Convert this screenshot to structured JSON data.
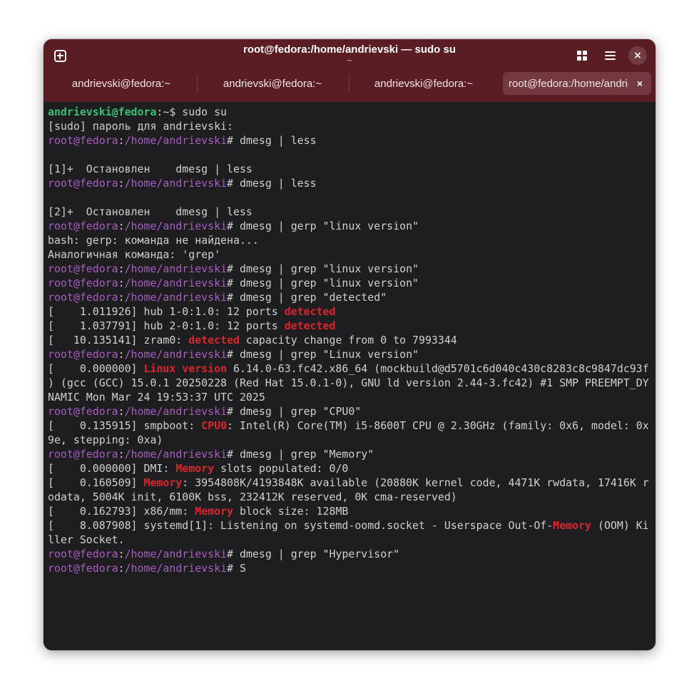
{
  "window": {
    "title": "root@fedora:/home/andrievski — sudo su",
    "subtitle": "~"
  },
  "tabs": [
    {
      "label": "andrievski@fedora:~"
    },
    {
      "label": "andrievski@fedora:~"
    },
    {
      "label": "andrievski@fedora:~"
    },
    {
      "label": "root@fedora:/home/andrievski — sudo su",
      "close": "×"
    }
  ],
  "header_icons": {
    "new_tab": "new-tab-icon",
    "overview": "tab-overview-icon",
    "menu": "hamburger-menu-icon",
    "close": "×"
  },
  "colors": {
    "headerbar": "#5b1d24",
    "terminal_bg": "#1e1e21",
    "user_prompt": "#3fbf73",
    "root_prompt": "#a85ec1",
    "grep_highlight": "#d8262d",
    "text": "#d0d0d0"
  },
  "terminal": {
    "lines": [
      [
        {
          "t": "andrievski@fedora",
          "c": "user-green"
        },
        {
          "t": ":~$ sudo su",
          "c": "plain"
        }
      ],
      [
        {
          "t": "[sudo] пароль для andrievski:",
          "c": "plain"
        }
      ],
      [
        {
          "t": "root@fedora",
          "c": "root-purple"
        },
        {
          "t": ":",
          "c": "plain"
        },
        {
          "t": "/home/andrievski",
          "c": "root-purple"
        },
        {
          "t": "# dmesg | less",
          "c": "plain"
        }
      ],
      [],
      [
        {
          "t": "[1]+  Остановлен    dmesg | less",
          "c": "plain"
        }
      ],
      [
        {
          "t": "root@fedora",
          "c": "root-purple"
        },
        {
          "t": ":",
          "c": "plain"
        },
        {
          "t": "/home/andrievski",
          "c": "root-purple"
        },
        {
          "t": "# dmesg | less",
          "c": "plain"
        }
      ],
      [],
      [
        {
          "t": "[2]+  Остановлен    dmesg | less",
          "c": "plain"
        }
      ],
      [
        {
          "t": "root@fedora",
          "c": "root-purple"
        },
        {
          "t": ":",
          "c": "plain"
        },
        {
          "t": "/home/andrievski",
          "c": "root-purple"
        },
        {
          "t": "# dmesg | gerp \"linux version\"",
          "c": "plain"
        }
      ],
      [
        {
          "t": "bash: gerp: команда не найдена...",
          "c": "plain"
        }
      ],
      [
        {
          "t": "Аналогичная команда: 'grep'",
          "c": "plain"
        }
      ],
      [
        {
          "t": "root@fedora",
          "c": "root-purple"
        },
        {
          "t": ":",
          "c": "plain"
        },
        {
          "t": "/home/andrievski",
          "c": "root-purple"
        },
        {
          "t": "# dmesg | grep \"linux version\"",
          "c": "plain"
        }
      ],
      [
        {
          "t": "root@fedora",
          "c": "root-purple"
        },
        {
          "t": ":",
          "c": "plain"
        },
        {
          "t": "/home/andrievski",
          "c": "root-purple"
        },
        {
          "t": "# dmesg | grep \"linux version\"",
          "c": "plain"
        }
      ],
      [
        {
          "t": "root@fedora",
          "c": "root-purple"
        },
        {
          "t": ":",
          "c": "plain"
        },
        {
          "t": "/home/andrievski",
          "c": "root-purple"
        },
        {
          "t": "# dmesg | grep \"detected\"",
          "c": "plain"
        }
      ],
      [
        {
          "t": "[    1.011926] hub 1-0:1.0: 12 ports ",
          "c": "plain"
        },
        {
          "t": "detected",
          "c": "hl"
        }
      ],
      [
        {
          "t": "[    1.037791] hub 2-0:1.0: 12 ports ",
          "c": "plain"
        },
        {
          "t": "detected",
          "c": "hl"
        }
      ],
      [
        {
          "t": "[   10.135141] zram0: ",
          "c": "plain"
        },
        {
          "t": "detected",
          "c": "hl"
        },
        {
          "t": " capacity change from 0 to 7993344",
          "c": "plain"
        }
      ],
      [
        {
          "t": "root@fedora",
          "c": "root-purple"
        },
        {
          "t": ":",
          "c": "plain"
        },
        {
          "t": "/home/andrievski",
          "c": "root-purple"
        },
        {
          "t": "# dmesg | grep \"Linux version\"",
          "c": "plain"
        }
      ],
      [
        {
          "t": "[    0.000000] ",
          "c": "plain"
        },
        {
          "t": "Linux version",
          "c": "hl"
        },
        {
          "t": " 6.14.0-63.fc42.x86_64 (mockbuild@d5701c6d040c430c8283c8c9847dc93f",
          "c": "plain"
        }
      ],
      [
        {
          "t": ") (gcc (GCC) 15.0.1 20250228 (Red Hat 15.0.1-0), GNU ld version 2.44-3.fc42) #1 SMP PREEMPT_DY",
          "c": "plain"
        }
      ],
      [
        {
          "t": "NAMIC Mon Mar 24 19:53:37 UTC 2025",
          "c": "plain"
        }
      ],
      [
        {
          "t": "root@fedora",
          "c": "root-purple"
        },
        {
          "t": ":",
          "c": "plain"
        },
        {
          "t": "/home/andrievski",
          "c": "root-purple"
        },
        {
          "t": "# dmesg | grep \"CPU0\"",
          "c": "plain"
        }
      ],
      [
        {
          "t": "[    0.135915] smpboot: ",
          "c": "plain"
        },
        {
          "t": "CPU0",
          "c": "hl"
        },
        {
          "t": ": Intel(R) Core(TM) i5-8600T CPU @ 2.30GHz (family: 0x6, model: 0x",
          "c": "plain"
        }
      ],
      [
        {
          "t": "9e, stepping: 0xa)",
          "c": "plain"
        }
      ],
      [
        {
          "t": "root@fedora",
          "c": "root-purple"
        },
        {
          "t": ":",
          "c": "plain"
        },
        {
          "t": "/home/andrievski",
          "c": "root-purple"
        },
        {
          "t": "# dmesg | grep \"Memory\"",
          "c": "plain"
        }
      ],
      [
        {
          "t": "[    0.000000] DMI: ",
          "c": "plain"
        },
        {
          "t": "Memory",
          "c": "hl"
        },
        {
          "t": " slots populated: 0/0",
          "c": "plain"
        }
      ],
      [
        {
          "t": "[    0.160509] ",
          "c": "plain"
        },
        {
          "t": "Memory",
          "c": "hl"
        },
        {
          "t": ": 3954808K/4193848K available (20880K kernel code, 4471K rwdata, 17416K r",
          "c": "plain"
        }
      ],
      [
        {
          "t": "odata, 5004K init, 6100K bss, 232412K reserved, 0K cma-reserved)",
          "c": "plain"
        }
      ],
      [
        {
          "t": "[    0.162793] x86/mm: ",
          "c": "plain"
        },
        {
          "t": "Memory",
          "c": "hl"
        },
        {
          "t": " block size: 128MB",
          "c": "plain"
        }
      ],
      [
        {
          "t": "[    8.087908] systemd[1]: Listening on systemd-oomd.socket - Userspace Out-Of-",
          "c": "plain"
        },
        {
          "t": "Memory",
          "c": "hl"
        },
        {
          "t": " (OOM) Ki",
          "c": "plain"
        }
      ],
      [
        {
          "t": "ller Socket.",
          "c": "plain"
        }
      ],
      [
        {
          "t": "root@fedora",
          "c": "root-purple"
        },
        {
          "t": ":",
          "c": "plain"
        },
        {
          "t": "/home/andrievski",
          "c": "root-purple"
        },
        {
          "t": "# dmesg | grep \"Hypervisor\"",
          "c": "plain"
        }
      ],
      [
        {
          "t": "root@fedora",
          "c": "root-purple"
        },
        {
          "t": ":",
          "c": "plain"
        },
        {
          "t": "/home/andrievski",
          "c": "root-purple"
        },
        {
          "t": "# S",
          "c": "plain"
        }
      ]
    ]
  }
}
